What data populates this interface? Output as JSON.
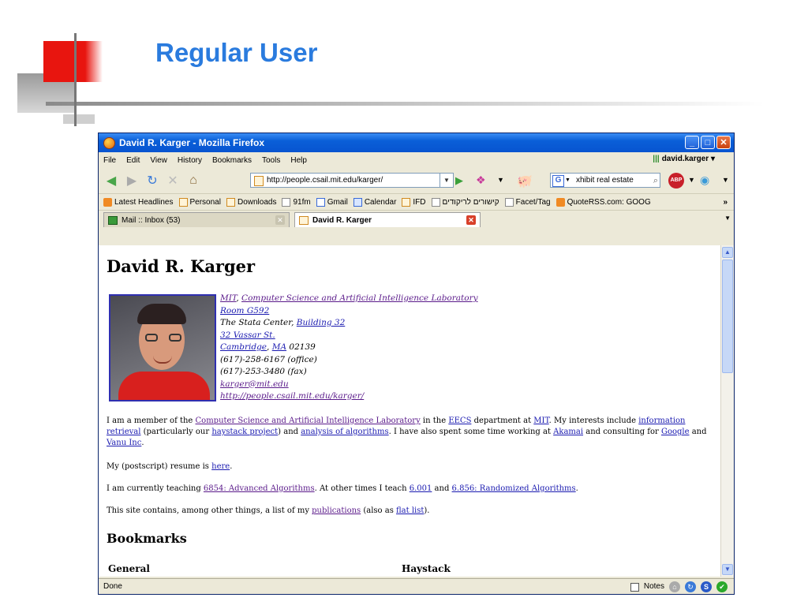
{
  "slide": {
    "title": "Regular User"
  },
  "window": {
    "title": "David R. Karger - Mozilla Firefox"
  },
  "menu": [
    "File",
    "Edit",
    "View",
    "History",
    "Bookmarks",
    "Tools",
    "Help"
  ],
  "user": "david.karger",
  "nav": {
    "url": "http://people.csail.mit.edu/karger/",
    "search_text": "xhibit real estate",
    "search_engine": "G"
  },
  "bookmarks": [
    {
      "label": "Latest Headlines",
      "icon": "rss"
    },
    {
      "label": "Personal",
      "icon": "folder"
    },
    {
      "label": "Downloads",
      "icon": "folder"
    },
    {
      "label": "91fm",
      "icon": "page"
    },
    {
      "label": "Gmail",
      "icon": "g"
    },
    {
      "label": "Calendar",
      "icon": "cal"
    },
    {
      "label": "IFD",
      "icon": "folder"
    },
    {
      "label": "קישורים לריקודים",
      "icon": "page"
    },
    {
      "label": "Facet/Tag",
      "icon": "page"
    },
    {
      "label": "QuoteRSS.com: GOOG",
      "icon": "rss"
    }
  ],
  "bookmarks_more": "»",
  "tabs": {
    "inbox": "Mail :: Inbox (53)",
    "active": "David R. Karger"
  },
  "page": {
    "heading": "David R. Karger",
    "addr": {
      "mit": "MIT",
      "lab": "Computer Science and Artificial Intelligence Laboratory",
      "room": "Room G592",
      "stata_prefix": "The Stata Center, ",
      "building": "Building 32",
      "street": "32 Vassar St. ",
      "city": "Cambridge",
      "state": "MA",
      "zip": " 02139",
      "office": "(617)-258-6167 (office)",
      "fax": "(617)-253-3480 (fax)",
      "email": "karger@mit.edu",
      "homepage": "http://people.csail.mit.edu/karger/"
    },
    "p1": {
      "t1": "I am a member of the ",
      "l1": "Computer Science and Artificial Intelligence Laboratory",
      "t2": " in the ",
      "l2": "EECS",
      "t3": " department at ",
      "l3": "MIT",
      "t4": ". My interests include ",
      "l4": "information retrieval",
      "t5": " (particularly our ",
      "l5": "haystack project",
      "t6": ") and ",
      "l6": "analysis of algorithms",
      "t7": ". I have also spent some time working at ",
      "l7": "Akamai",
      "t8": " and consulting for ",
      "l8": "Google",
      "t9": " and ",
      "l9": "Vanu Inc",
      "t10": "."
    },
    "p2": {
      "t1": "My (postscript) resume is ",
      "l1": "here",
      "t2": "."
    },
    "p3": {
      "t1": "I am currently teaching ",
      "l1": "6854: Advanced Algorithms",
      "t2": ". At other times I teach ",
      "l2": "6.001",
      "t3": " and ",
      "l3": "6.856: Randomized Algorithms",
      "t4": "."
    },
    "p4": {
      "t1": "This site contains, among other things, a list of my ",
      "l1": "publications",
      "t2": " (also as ",
      "l2": "flat list",
      "t3": ")."
    },
    "bookmarks_heading": "Bookmarks",
    "col_general": "General",
    "col_haystack": "Haystack"
  },
  "status": {
    "text": "Done",
    "notes": "Notes"
  }
}
